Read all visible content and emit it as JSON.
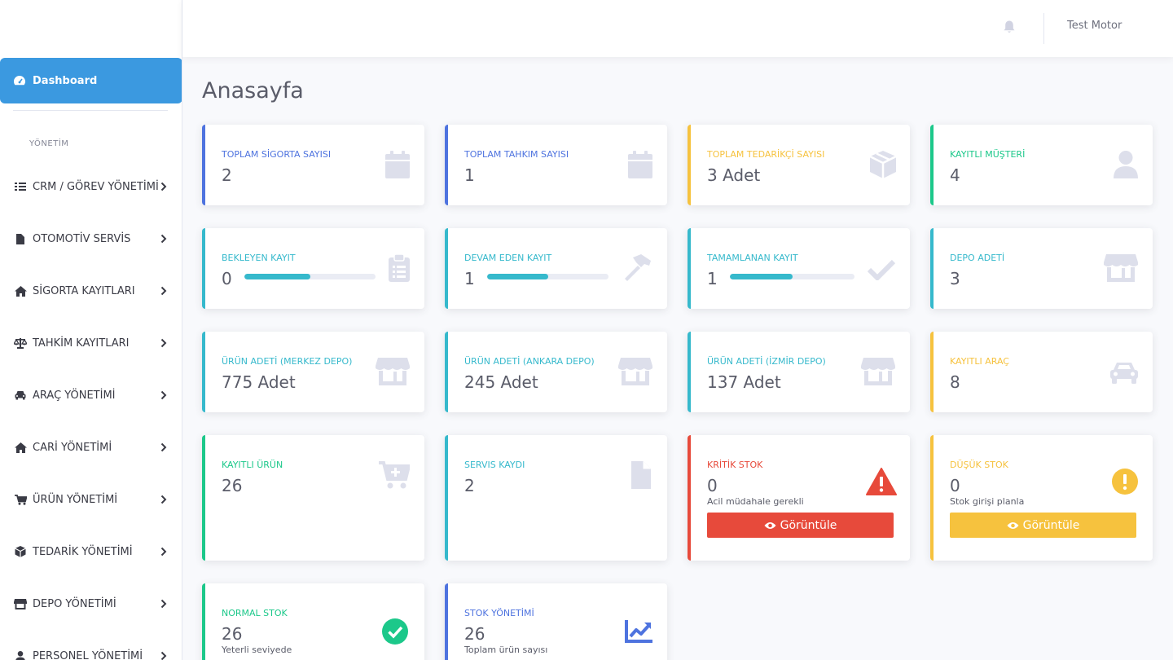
{
  "topbar": {
    "user_name": "Test Motor",
    "bell_icon": "bell-icon"
  },
  "sidebar": {
    "dashboard_label": "Dashboard",
    "heading": "YÖNETİM",
    "items": [
      {
        "label": "CRM / GÖREV YÖNETİMİ",
        "icon": "tasks-icon"
      },
      {
        "label": "OTOMOTİV SERVİS",
        "icon": "file-icon"
      },
      {
        "label": "SİGORTA KAYITLARI",
        "icon": "home-icon"
      },
      {
        "label": "TAHKİM KAYITLARI",
        "icon": "balance-scale-icon"
      },
      {
        "label": "ARAÇ YÖNETİMİ",
        "icon": "car-icon"
      },
      {
        "label": "CARİ YÖNETİMİ",
        "icon": "home-icon"
      },
      {
        "label": "ÜRÜN YÖNETİMİ",
        "icon": "cart-icon"
      },
      {
        "label": "TEDARİK YÖNETİMİ",
        "icon": "box-icon"
      },
      {
        "label": "DEPO YÖNETİMİ",
        "icon": "store-icon"
      },
      {
        "label": "PERSONEL YÖNETİMİ",
        "icon": "user-icon"
      }
    ]
  },
  "page": {
    "title": "Anasayfa"
  },
  "cards": {
    "sigorta": {
      "label": "TOPLAM SİGORTA SAYISI",
      "value": "2"
    },
    "tahkim": {
      "label": "TOPLAM TAHKIM SAYISI",
      "value": "1"
    },
    "tedarikci": {
      "label": "TOPLAM TEDARİKÇİ SAYISI",
      "value": "3 Adet"
    },
    "musteri": {
      "label": "KAYITLI MÜŞTERİ",
      "value": "4"
    },
    "bekleyen": {
      "label": "BEKLEYEN KAYIT",
      "value": "0",
      "progress": 0.5
    },
    "devam": {
      "label": "DEVAM EDEN KAYIT",
      "value": "1",
      "progress": 0.5
    },
    "tamamlanan": {
      "label": "TAMAMLANAN KAYIT",
      "value": "1",
      "progress": 0.5
    },
    "depo": {
      "label": "DEPO ADETİ",
      "value": "3"
    },
    "merkez": {
      "label": "ÜRÜN ADETİ (MERKEZ DEPO)",
      "value": "775 Adet"
    },
    "ankara": {
      "label": "ÜRÜN ADETİ (ANKARA DEPO)",
      "value": "245 Adet"
    },
    "izmir": {
      "label": "ÜRÜN ADETİ (İZMİR DEPO)",
      "value": "137 Adet"
    },
    "arac": {
      "label": "KAYITLI ARAÇ",
      "value": "8"
    },
    "urun": {
      "label": "KAYITLI ÜRÜN",
      "value": "26"
    },
    "servis": {
      "label": "SERVIS KAYDI",
      "value": "2"
    },
    "kritik": {
      "label": "KRİTİK STOK",
      "value": "0",
      "sub": "Acil müdahale gerekli",
      "button": "Görüntüle"
    },
    "dusuk": {
      "label": "DÜŞÜK STOK",
      "value": "0",
      "sub": "Stok girişi planla",
      "button": "Görüntüle"
    },
    "normal": {
      "label": "NORMAL STOK",
      "value": "26",
      "sub": "Yeterli seviyede"
    },
    "stok": {
      "label": "STOK YÖNETİMİ",
      "value": "26",
      "sub": "Toplam ürün sayısı"
    }
  },
  "colors": {
    "primary": "#4e73df",
    "success": "#1cc88a",
    "info": "#36b9cc",
    "warning": "#f6c23e",
    "danger": "#e74a3b",
    "sidebar_active": "#3b99e0",
    "icon_muted": "#dddfeb"
  }
}
